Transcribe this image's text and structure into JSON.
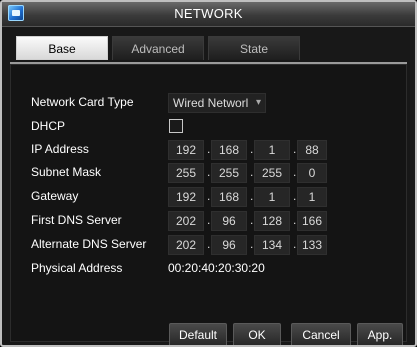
{
  "window": {
    "title": "NETWORK",
    "icon": "app-logo-icon"
  },
  "tabs": [
    {
      "label": "Base",
      "active": true
    },
    {
      "label": "Advanced",
      "active": false
    },
    {
      "label": "State",
      "active": false
    }
  ],
  "fields": {
    "network_card_type": {
      "label": "Network Card Type",
      "value": "Wired Networl",
      "arrow": "▾"
    },
    "dhcp": {
      "label": "DHCP",
      "checked": false
    },
    "ip_address": {
      "label": "IP Address",
      "octets": [
        "192",
        "168",
        "1",
        "88"
      ]
    },
    "subnet_mask": {
      "label": "Subnet Mask",
      "octets": [
        "255",
        "255",
        "255",
        "0"
      ]
    },
    "gateway": {
      "label": "Gateway",
      "octets": [
        "192",
        "168",
        "1",
        "1"
      ]
    },
    "first_dns": {
      "label": "First DNS Server",
      "octets": [
        "202",
        "96",
        "128",
        "166"
      ]
    },
    "alternate_dns": {
      "label": "Alternate DNS Server",
      "octets": [
        "202",
        "96",
        "134",
        "133"
      ]
    },
    "physical_address": {
      "label": "Physical Address",
      "value": "00:20:40:20:30:20"
    }
  },
  "buttons": {
    "default": "Default",
    "ok": "OK",
    "cancel": "Cancel",
    "apply": "App."
  },
  "separator": "."
}
